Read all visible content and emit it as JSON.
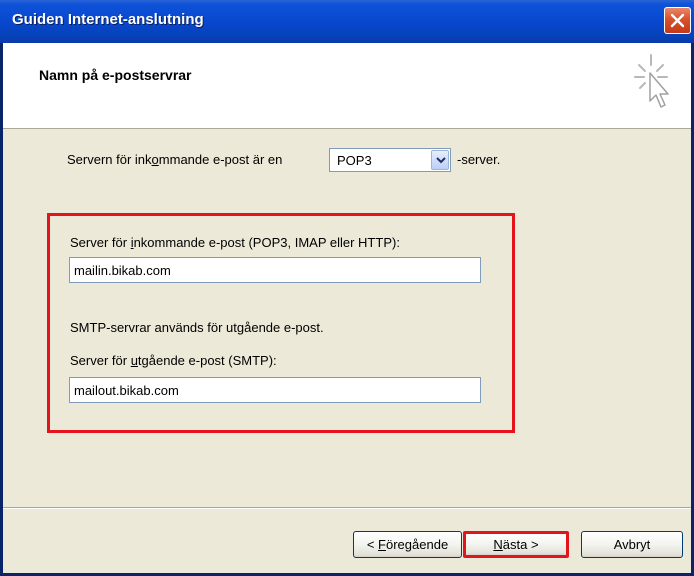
{
  "window": {
    "title": "Guiden Internet-anslutning"
  },
  "header": {
    "title": "Namn på e-postservrar"
  },
  "server_type": {
    "prefix_a": "Servern för ink",
    "prefix_u": "o",
    "prefix_b": "mmande e-post är en",
    "selected": "POP3",
    "suffix": "-server."
  },
  "incoming": {
    "label_a": "Server för ",
    "label_u": "i",
    "label_b": "nkommande e-post (POP3, IMAP eller HTTP):",
    "value": "mailin.bikab.com"
  },
  "smtp_note": "SMTP-servrar används för utgående e-post.",
  "outgoing": {
    "label_a": "Server för ",
    "label_u": "u",
    "label_b": "tgående e-post (SMTP):",
    "value": "mailout.bikab.com"
  },
  "buttons": {
    "back_pre": "< ",
    "back_u": "F",
    "back_rest": "öregående",
    "next_u": "N",
    "next_rest": "ästa >",
    "cancel": "Avbryt"
  },
  "colors": {
    "highlight": "#e4141c",
    "titlebar": "#0848cf",
    "dialog_bg": "#ece9d8"
  },
  "icons": [
    "close-icon",
    "wizard-cursor-icon",
    "chevron-down-icon"
  ]
}
